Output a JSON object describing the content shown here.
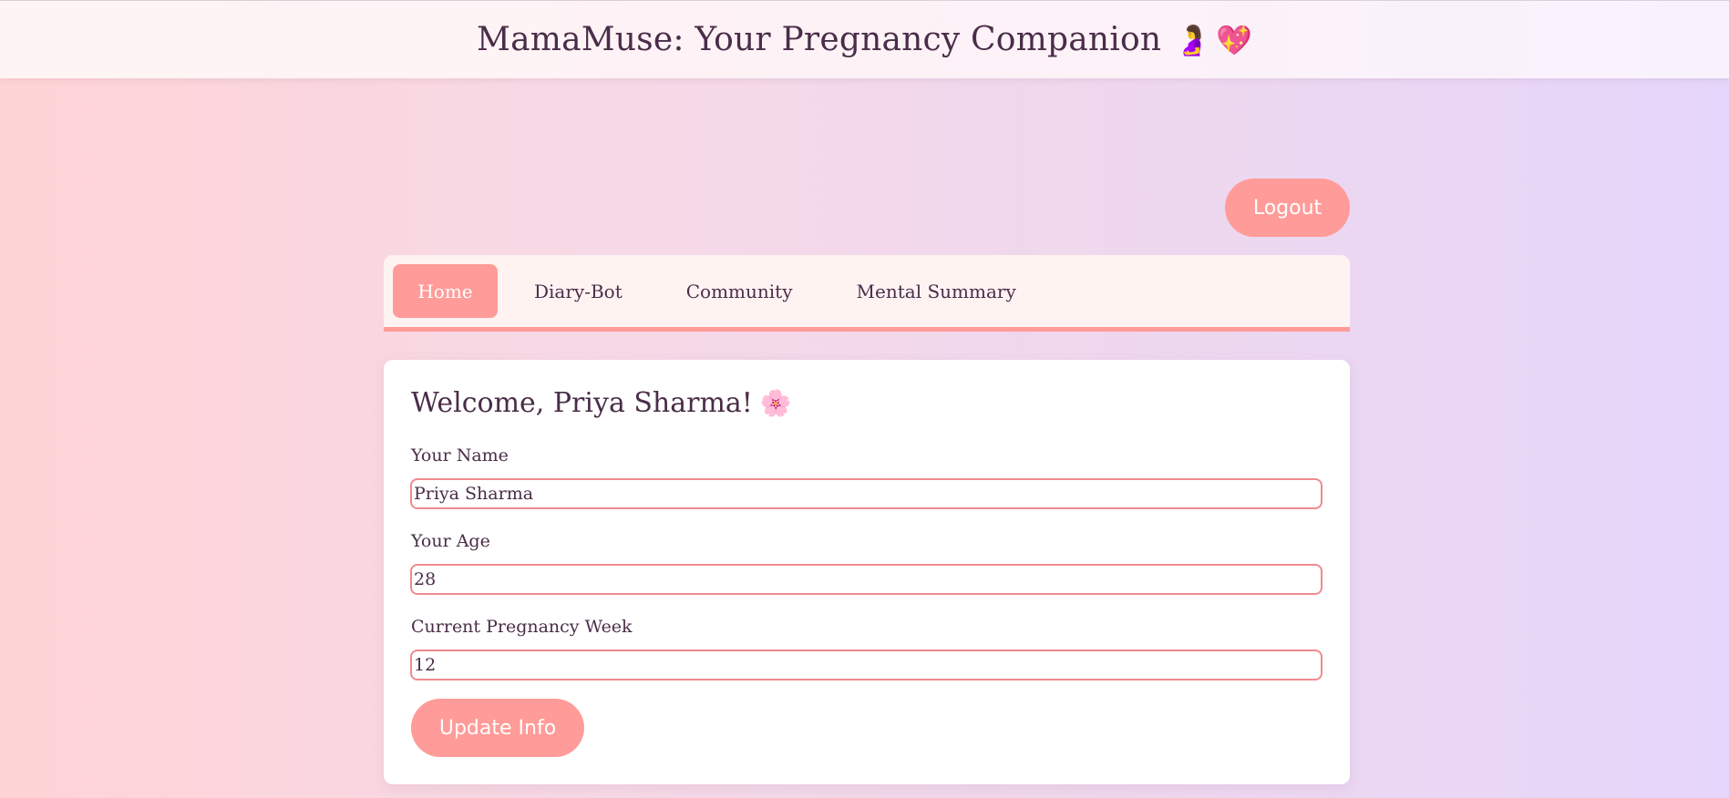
{
  "header": {
    "title": "MamaMuse: Your Pregnancy Companion",
    "emoji_1": "🤰",
    "emoji_2": "💖"
  },
  "logout_label": "Logout",
  "nav": {
    "tabs": [
      {
        "label": "Home",
        "active": true
      },
      {
        "label": "Diary-Bot",
        "active": false
      },
      {
        "label": "Community",
        "active": false
      },
      {
        "label": "Mental Summary",
        "active": false
      }
    ]
  },
  "profile": {
    "welcome_text": "Welcome, Priya Sharma!",
    "welcome_emoji": "🌸",
    "name_label": "Your Name",
    "name_value": "Priya Sharma",
    "age_label": "Your Age",
    "age_value": "28",
    "week_label": "Current Pregnancy Week",
    "week_value": "12",
    "update_label": "Update Info"
  },
  "colors": {
    "accent": "#ff9b98",
    "text": "#4a2d48",
    "input_border": "#f08a8f"
  }
}
